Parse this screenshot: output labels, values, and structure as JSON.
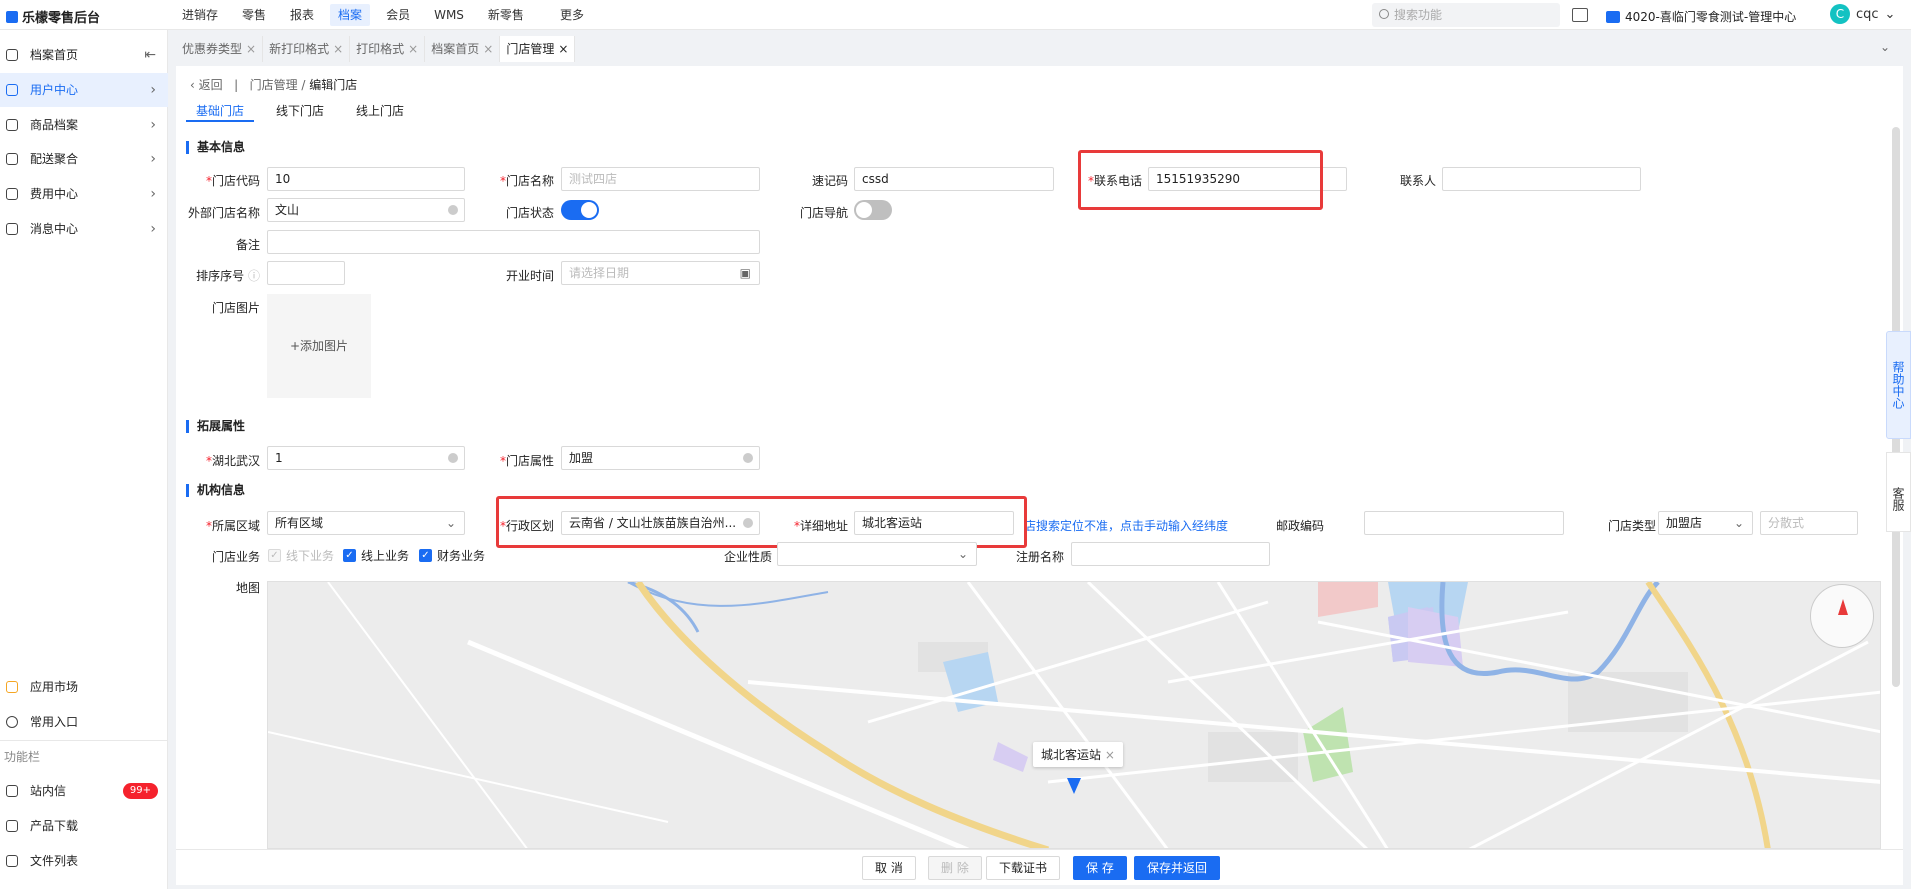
{
  "app": {
    "title": "乐檬零售后台"
  },
  "topnav": {
    "items": [
      "进销存",
      "零售",
      "报表",
      "档案",
      "会员",
      "WMS",
      "新零售",
      "更多"
    ],
    "active": "档案"
  },
  "search": {
    "placeholder": "搜索功能"
  },
  "org": {
    "name": "4020-喜临门零食测试-管理中心"
  },
  "user": {
    "initial": "C",
    "name": "cqc"
  },
  "sidebar": {
    "items": [
      {
        "label": "档案首页",
        "icon": "home-icon"
      },
      {
        "label": "用户中心",
        "icon": "user-icon"
      },
      {
        "label": "商品档案",
        "icon": "goods-icon"
      },
      {
        "label": "配送聚合",
        "icon": "delivery-icon"
      },
      {
        "label": "费用中心",
        "icon": "cost-icon"
      },
      {
        "label": "消息中心",
        "icon": "bell-icon"
      }
    ],
    "bottom": [
      {
        "label": "应用市场",
        "icon": "app-market-icon"
      },
      {
        "label": "常用入口",
        "icon": "heart-icon"
      }
    ],
    "section_label": "功能栏",
    "tools": [
      {
        "label": "站内信",
        "icon": "mail-icon",
        "badge": "99+"
      },
      {
        "label": "产品下载",
        "icon": "download-icon"
      },
      {
        "label": "文件列表",
        "icon": "file-list-icon"
      }
    ]
  },
  "tabs": [
    {
      "label": "优惠券类型"
    },
    {
      "label": "新打印格式"
    },
    {
      "label": "打印格式"
    },
    {
      "label": "档案首页"
    },
    {
      "label": "门店管理"
    }
  ],
  "breadcrumb": {
    "back": "返回",
    "parent": "门店管理",
    "separator": "/",
    "current": "编辑门店"
  },
  "subtabs": [
    "基础门店",
    "线下门店",
    "线上门店"
  ],
  "sections": {
    "basic": "基本信息",
    "ext": "拓展属性",
    "org": "机构信息"
  },
  "form": {
    "store_code": {
      "label": "门店代码",
      "value": "10"
    },
    "store_name": {
      "label": "门店名称",
      "placeholder": "测试四店"
    },
    "quick_code": {
      "label": "速记码",
      "value": "cssd"
    },
    "phone": {
      "label": "联系电话",
      "value": "15151935290"
    },
    "contact": {
      "label": "联系人",
      "value": ""
    },
    "ext_name": {
      "label": "外部门店名称",
      "value": "文山"
    },
    "status": {
      "label": "门店状态"
    },
    "nav": {
      "label": "门店导航"
    },
    "remark": {
      "label": "备注",
      "value": ""
    },
    "sort": {
      "label": "排序序号",
      "value": ""
    },
    "open_time": {
      "label": "开业时间",
      "placeholder": "请选择日期"
    },
    "image": {
      "label": "门店图片",
      "add": "+添加图片"
    },
    "hubei": {
      "label": "湖北武汉",
      "value": "1"
    },
    "attr": {
      "label": "门店属性",
      "value": "加盟"
    },
    "area": {
      "label": "所属区域",
      "value": "所有区域"
    },
    "district": {
      "label": "行政区划",
      "value": "云南省 / 文山壮族苗族自治州..."
    },
    "address": {
      "label": "详细地址",
      "value": "城北客运站"
    },
    "locate_hint": "店搜索定位不准，点击手动输入经纬度",
    "postcode": {
      "label": "邮政编码",
      "value": ""
    },
    "store_type": {
      "label": "门店类型",
      "value": "加盟店",
      "extra_placeholder": "分散式"
    },
    "business": {
      "label": "门店业务",
      "options": [
        "线下业务",
        "线上业务",
        "财务业务"
      ]
    },
    "company_nature": {
      "label": "企业性质",
      "value": ""
    },
    "reg_name": {
      "label": "注册名称",
      "value": ""
    },
    "map": {
      "label": "地图",
      "marker": "城北客运站"
    }
  },
  "help": {
    "label": "帮助中心"
  },
  "service": {
    "label": "客服"
  },
  "footer": {
    "cancel": "取 消",
    "delete": "删 除",
    "download": "下载证书",
    "save": "保 存",
    "save_back": "保存并返回"
  },
  "colors": {
    "primary": "#1a6cf2",
    "highlight": "#e83a3a",
    "danger": "#f5222d"
  }
}
